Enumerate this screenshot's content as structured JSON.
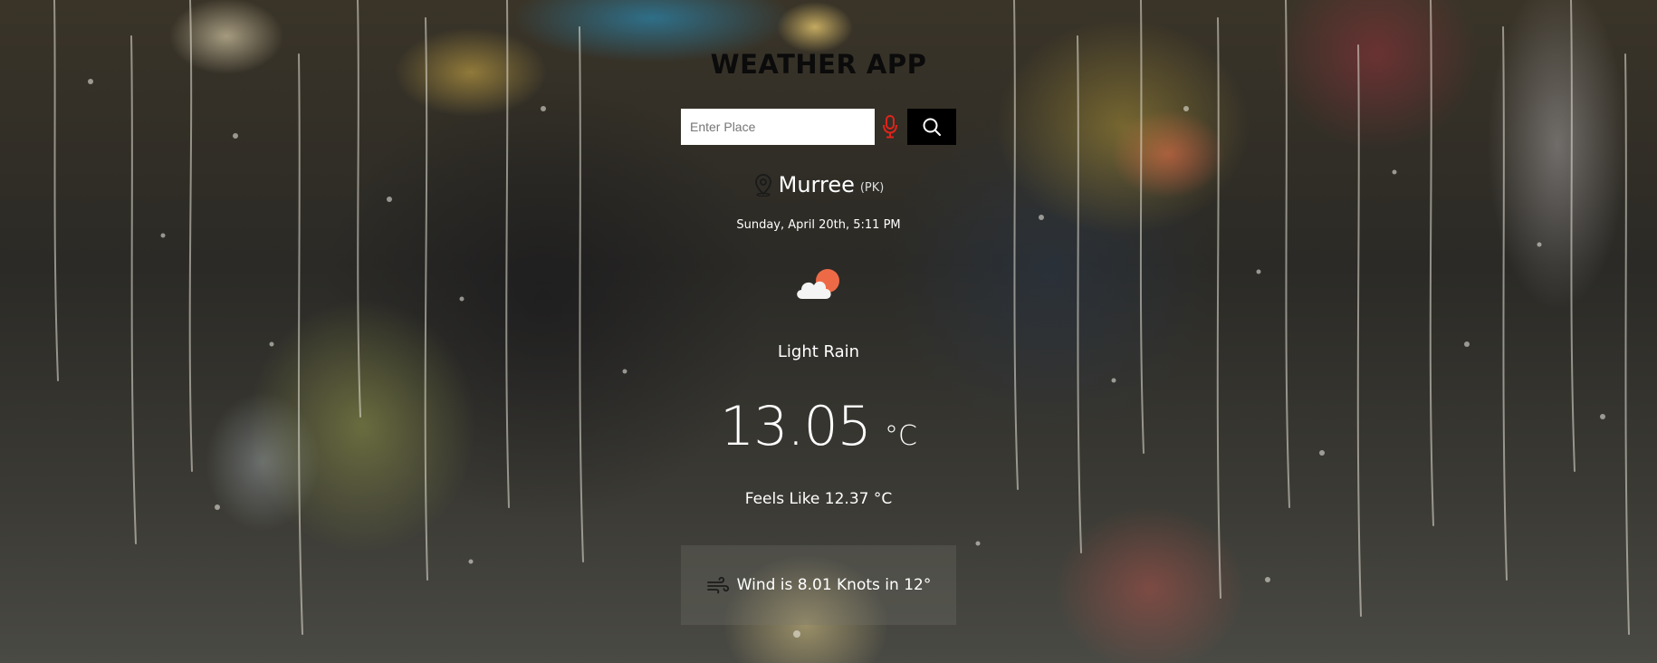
{
  "app": {
    "title": "WEATHER APP"
  },
  "search": {
    "placeholder": "Enter Place",
    "value": "",
    "icons": {
      "mic": "microphone-icon",
      "search": "search-icon"
    },
    "colors": {
      "mic": "#e0241b",
      "button": "#000000"
    }
  },
  "location": {
    "icon": "location-pin-icon",
    "city": "Murree",
    "country": "(PK)"
  },
  "datetime": "Sunday, April 20th, 5:11 PM",
  "weather": {
    "icon": "cloud-sun-icon",
    "condition": "Light Rain",
    "temperature": "13.05",
    "unit": "°C",
    "feels_like": "Feels Like 12.37 °C"
  },
  "wind": {
    "icon": "wind-icon",
    "text": "Wind is 8.01 Knots in 12°"
  }
}
